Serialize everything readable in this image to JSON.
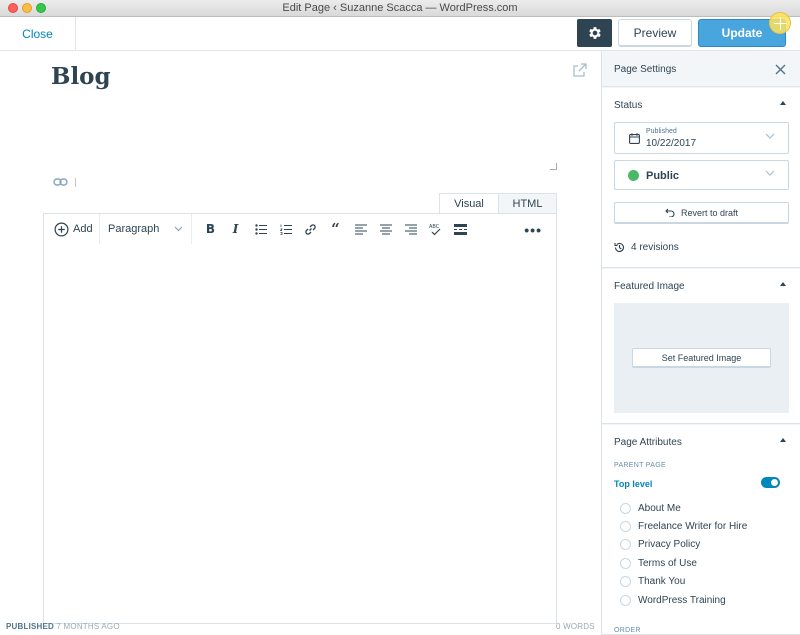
{
  "window": {
    "title": "Edit Page ‹ Suzanne Scacca — WordPress.com"
  },
  "topbar": {
    "close_label": "Close",
    "preview_label": "Preview",
    "update_label": "Update"
  },
  "editor": {
    "title": "Blog",
    "tabs": [
      "Visual",
      "HTML"
    ],
    "toolbar": {
      "add_label": "Add",
      "format_value": "Paragraph",
      "icons": [
        "bold-icon",
        "italic-icon",
        "bullet-list-icon",
        "numbered-list-icon",
        "link-icon",
        "quote-icon",
        "align-left-icon",
        "align-center-icon",
        "align-right-icon",
        "spellcheck-icon",
        "more-tag-icon",
        "more-options-icon"
      ]
    },
    "footer": {
      "status": "PUBLISHED",
      "published_ago": "7 MONTHS AGO",
      "word_count": "0 WORDS"
    }
  },
  "sidebar": {
    "title": "Page Settings",
    "status": {
      "title": "Status",
      "date_label": "Published",
      "date_value": "10/22/2017",
      "visibility": "Public",
      "revert_label": "Revert to draft",
      "revisions_label": "4 revisions"
    },
    "featured": {
      "title": "Featured Image",
      "button_label": "Set Featured Image"
    },
    "attributes": {
      "title": "Page Attributes",
      "parent_label": "PARENT PAGE",
      "top_level_label": "Top level",
      "pages": [
        "About Me",
        "Freelance Writer for Hire",
        "Privacy Policy",
        "Terms of Use",
        "Thank You",
        "WordPress Training"
      ],
      "order_label": "ORDER"
    }
  },
  "colors": {
    "accent": "#0087be",
    "update": "#48a5dd",
    "dark": "#2e4453",
    "success": "#4ab866"
  }
}
